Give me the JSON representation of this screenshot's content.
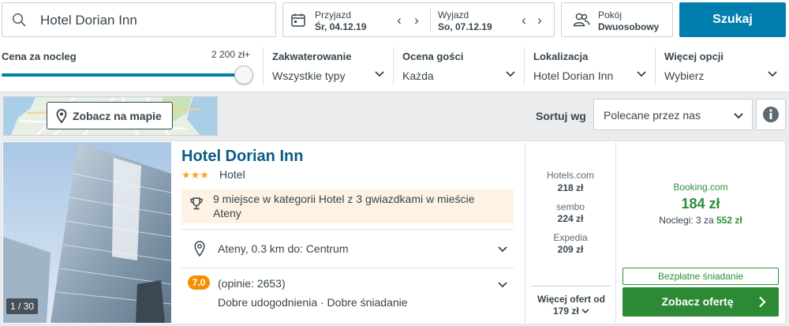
{
  "search": {
    "query": "Hotel Dorian Inn",
    "button_label": "Szukaj"
  },
  "dates": {
    "checkin_label": "Przyjazd",
    "checkin_value": "Śr, 04.12.19",
    "checkout_label": "Wyjazd",
    "checkout_value": "So, 07.12.19",
    "prev_arrow": "‹",
    "next_arrow": "›"
  },
  "rooms": {
    "label": "Pokój",
    "value": "Dwuosobowy"
  },
  "filters": {
    "price": {
      "title": "Cena za nocleg",
      "max_label": "2 200 zł+",
      "slider_fraction": 1.0
    },
    "accommodation": {
      "title": "Zakwaterowanie",
      "value": "Wszystkie typy"
    },
    "rating": {
      "title": "Ocena gości",
      "value": "Każda"
    },
    "location": {
      "title": "Lokalizacja",
      "value": "Hotel Dorian Inn"
    },
    "more": {
      "title": "Więcej opcji",
      "value": "Wybierz"
    }
  },
  "map": {
    "button_label": "Zobacz na mapie"
  },
  "sort": {
    "label": "Sortuj wg",
    "value": "Polecane przez nas"
  },
  "result": {
    "photo_counter": "1 / 30",
    "name": "Hotel Dorian Inn",
    "stars": "★★★",
    "star_count": 3,
    "type": "Hotel",
    "ranking": "9 miejsce w kategorii Hotel z 3 gwiazdkami w mieście Ateny",
    "location": "Ateny, 0.3 km do: Centrum",
    "rating_score": "7.0",
    "rating_count": "(opinie: 2653)",
    "rating_desc": "Dobre udogodnienia · Dobre śniadanie",
    "deals": [
      {
        "site": "Hotels.com",
        "price": "218 zł"
      },
      {
        "site": "sembo",
        "price": "224 zł"
      },
      {
        "site": "Expedia",
        "price": "209 zł"
      }
    ],
    "more_deals_label": "Więcej ofert od",
    "more_deals_price": "179 zł",
    "best_site": "Booking.com",
    "best_price": "184 zł",
    "nights_prefix": "Noclegi: 3 za",
    "nights_total": "552 zł",
    "breakfast_tag": "Bezpłatne śniadanie",
    "deal_button": "Zobacz ofertę"
  },
  "colors": {
    "accent": "#007faf",
    "deal_green": "#2c8a35",
    "rating_orange": "#f48f00",
    "title_blue": "#0a5c84"
  }
}
